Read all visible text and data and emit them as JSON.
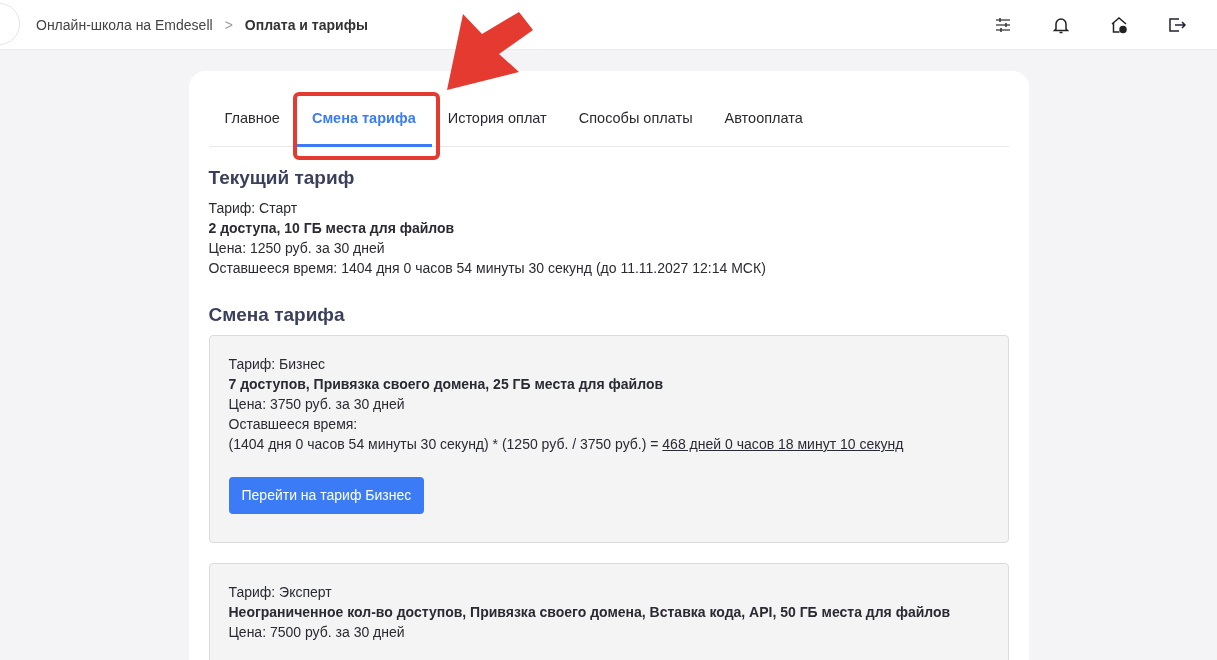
{
  "breadcrumb": [
    {
      "label": "Онлайн-школа на Emdesell",
      "current": false
    },
    {
      "label": "Оплата и тарифы",
      "current": true
    }
  ],
  "breadcrumb_separator": ">",
  "tabs": [
    {
      "label": "Главное",
      "selected": false
    },
    {
      "label": "Смена тарифа",
      "selected": true
    },
    {
      "label": "История оплат",
      "selected": false
    },
    {
      "label": "Способы оплаты",
      "selected": false
    },
    {
      "label": "Автооплата",
      "selected": false
    }
  ],
  "current_plan": {
    "heading": "Текущий тариф",
    "name": "Тариф: Старт",
    "features": "2 доступа, 10 ГБ места для файлов",
    "price": "Цена: 1250 руб. за 30 дней",
    "remaining": "Оставшееся время: 1404 дня 0 часов 54 минуты 30 секунд (до 11.11.2027 12:14 МСК)"
  },
  "change_heading": "Смена тарифа",
  "plans": [
    {
      "name": "Тариф: Бизнес",
      "features": "7 доступов, Привязка своего домена, 25 ГБ места для файлов",
      "price": "Цена: 3750 руб. за 30 дней",
      "remaining_label": "Оставшееся время:",
      "formula": "(1404 дня 0 часов 54 минуты 30 секунд) * (1250 руб. / 3750 руб.) = ",
      "result": "468 дней 0 часов 18 минут 10 секунд",
      "button": "Перейти на тариф Бизнес"
    },
    {
      "name": "Тариф: Эксперт",
      "features": "Неограниченное кол-во доступов, Привязка своего домена, Вставка кода, API, 50 ГБ места для файлов",
      "price": "Цена: 7500 руб. за 30 дней"
    }
  ]
}
